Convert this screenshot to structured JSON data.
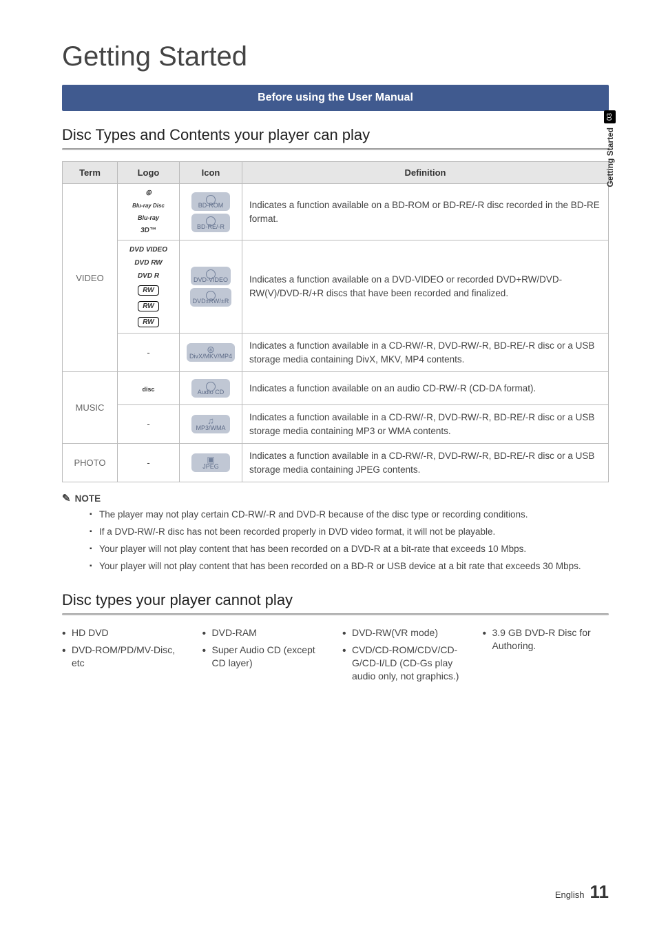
{
  "side": {
    "chapter": "03",
    "label": "Getting Started"
  },
  "title": "Getting Started",
  "banner": "Before using the User Manual",
  "sub1": "Disc Types and Contents your player can play",
  "table": {
    "headers": {
      "term": "Term",
      "logo": "Logo",
      "icon": "Icon",
      "def": "Definition"
    },
    "video_term": "VIDEO",
    "music_term": "MUSIC",
    "photo_term": "PHOTO",
    "rows": {
      "bd": {
        "logos": {
          "a": "Blu-ray Disc",
          "b": "Blu-ray",
          "c": "3D™"
        },
        "icons": {
          "a": "BD-ROM",
          "b": "BD-RE/-R"
        },
        "def": "Indicates a function available on a BD-ROM or BD-RE/-R disc recorded in the BD-RE format."
      },
      "dvd": {
        "logos": {
          "a": "DVD VIDEO",
          "b": "DVD RW",
          "c": "DVD R",
          "d": "RW DVD+ReWritable",
          "e": "RW DVD+R",
          "f": "RW DVD+R"
        },
        "icons": {
          "a": "DVD-VIDEO",
          "b": "DVD±RW/±R"
        },
        "def": "Indicates a function available on a DVD-VIDEO or recorded DVD+RW/DVD-RW(V)/DVD-R/+R discs that have been recorded and finalized."
      },
      "divx": {
        "logo_dash": "-",
        "icon": "DivX/MKV/MP4",
        "def": "Indicates a function available in a CD-RW/-R, DVD-RW/-R, BD-RE/-R disc or a USB storage media containing DivX, MKV, MP4 contents."
      },
      "cd": {
        "logo": "COMPACT disc DIGITAL AUDIO",
        "icon": "Audio CD",
        "def": "Indicates a function available on an audio CD-RW/-R (CD-DA format)."
      },
      "mp3": {
        "logo_dash": "-",
        "icon": "MP3/WMA",
        "def": "Indicates a function available in a CD-RW/-R, DVD-RW/-R, BD-RE/-R disc or a USB storage media containing MP3 or WMA contents."
      },
      "photo": {
        "logo_dash": "-",
        "icon": "JPEG",
        "def": "Indicates a function available in a CD-RW/-R, DVD-RW/-R, BD-RE/-R disc or a USB storage media containing JPEG contents."
      }
    }
  },
  "note": {
    "head": "NOTE",
    "items": [
      "The player may not play certain CD-RW/-R and DVD-R because of the disc type or recording conditions.",
      "If a DVD-RW/-R disc has not been recorded properly in DVD video format, it will not be playable.",
      "Your player will not play content that has been recorded on a DVD-R at a bit-rate that exceeds 10 Mbps.",
      "Your player will not play content that has been recorded on a BD-R or USB device at a bit rate that exceeds 30 Mbps."
    ]
  },
  "sub2": "Disc types your player cannot play",
  "cannot": {
    "col1": [
      "HD DVD",
      "DVD-ROM/PD/MV-Disc, etc"
    ],
    "col2": [
      "DVD-RAM",
      "Super Audio CD (except CD layer)"
    ],
    "col3": [
      "DVD-RW(VR mode)",
      "CVD/CD-ROM/CDV/CD-G/CD-I/LD (CD-Gs play audio only, not graphics.)"
    ],
    "col4": [
      "3.9 GB DVD-R Disc for Authoring."
    ]
  },
  "footer": {
    "lang": "English",
    "page": "11"
  }
}
